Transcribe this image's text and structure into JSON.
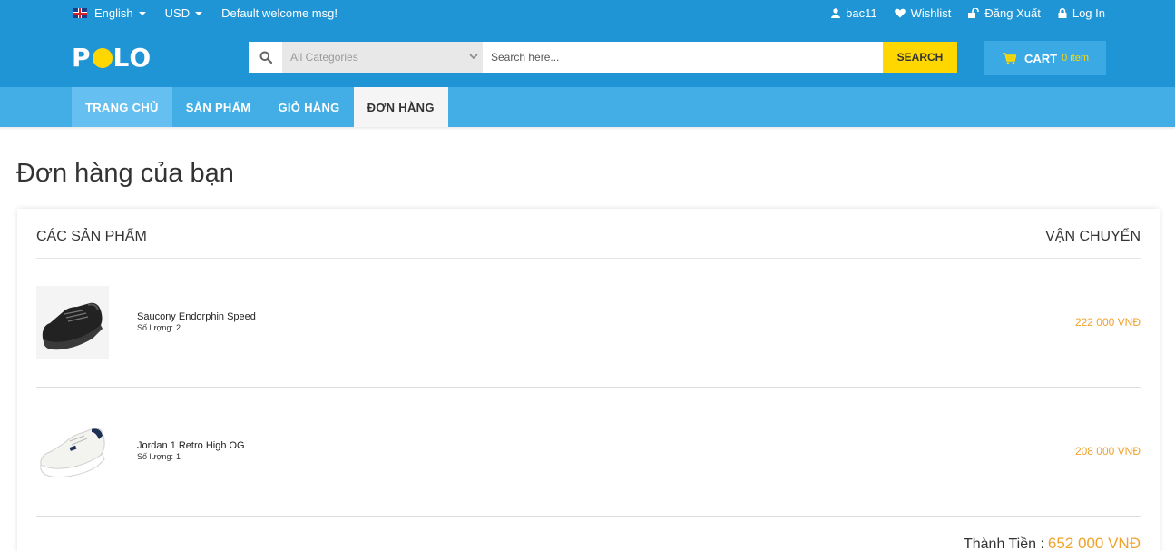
{
  "topbar": {
    "language": "English",
    "currency": "USD",
    "welcome": "Default welcome msg!",
    "user": "bac11",
    "wishlist": "Wishlist",
    "logout": "Đăng Xuất",
    "login": "Log In"
  },
  "header": {
    "logo": "POLO",
    "category_placeholder": "All Categories",
    "search_placeholder": "Search here...",
    "search_button": "SEARCH",
    "cart_label": "CART",
    "cart_count": "0 item"
  },
  "nav": {
    "items": [
      {
        "label": "TRANG CHỦ"
      },
      {
        "label": "SẢN PHẨM"
      },
      {
        "label": "GIỎ HÀNG"
      },
      {
        "label": "ĐƠN HÀNG"
      }
    ]
  },
  "main": {
    "title": "Đơn hàng của bạn",
    "col_products": "CÁC SẢN PHẨM",
    "col_shipping": "VẬN CHUYỂN",
    "qty_label": "Số lượng:",
    "orders": [
      {
        "name": "Saucony Endorphin Speed",
        "qty": "2",
        "price": "222 000 VNĐ",
        "image": "black-shoe"
      },
      {
        "name": "Jordan 1 Retro High OG",
        "qty": "1",
        "price": "208 000 VNĐ",
        "image": "white-shoe"
      }
    ],
    "total_label": "Thành Tiền :",
    "total_value": "652 000 VNĐ"
  },
  "colors": {
    "primary": "#1f95d6",
    "nav": "#43aee6",
    "accent": "#fed700",
    "price": "#f0a22c"
  }
}
